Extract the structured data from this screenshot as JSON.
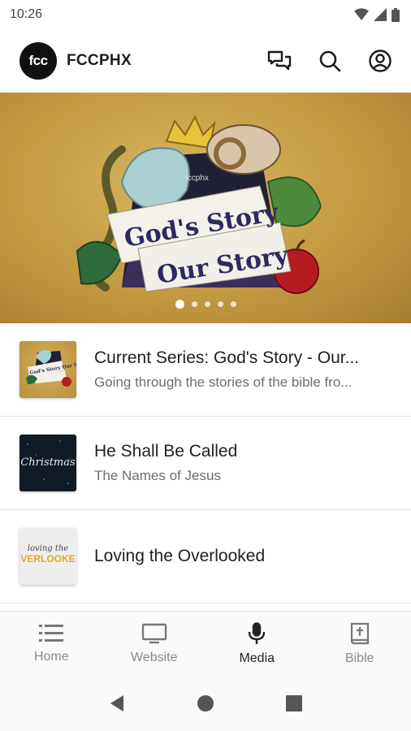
{
  "status_bar": {
    "time": "10:26",
    "icons": [
      "wifi-icon",
      "signal-icon",
      "battery-icon"
    ]
  },
  "app_bar": {
    "logo_text": "fcc",
    "title": "FCCPHX",
    "actions": [
      "chat-icon",
      "search-icon",
      "account-icon"
    ]
  },
  "hero": {
    "title_line1": "God's Story",
    "title_line2": "Our Story",
    "brand": "fccphx",
    "slide_count": 5,
    "active_slide": 1
  },
  "list": {
    "items": [
      {
        "title": "Current Series: God's Story - Our...",
        "subtitle": "Going through the stories of the bible fro...",
        "thumb_text": "God's Story Our Story"
      },
      {
        "title": "He Shall Be Called",
        "subtitle": "The Names of Jesus",
        "thumb_text": "Christmas"
      },
      {
        "title": "Loving the Overlooked",
        "subtitle": "",
        "thumb_text_1": "loving the",
        "thumb_text_2": "VERLOOKE"
      }
    ]
  },
  "bottom_nav": {
    "items": [
      {
        "label": "Home",
        "icon": "list-icon"
      },
      {
        "label": "Website",
        "icon": "monitor-icon"
      },
      {
        "label": "Media",
        "icon": "microphone-icon"
      },
      {
        "label": "Bible",
        "icon": "bible-icon"
      }
    ],
    "active": "Media"
  },
  "colors": {
    "accent": "#c49a42",
    "text": "#1f1f1f",
    "muted": "#6e6e6e"
  }
}
